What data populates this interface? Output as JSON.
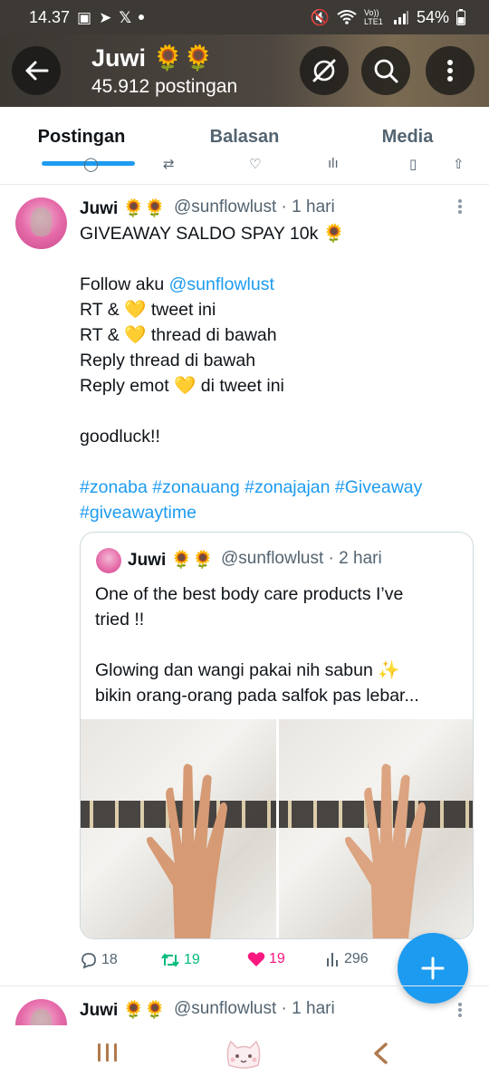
{
  "status_bar": {
    "time": "14.37",
    "battery": "54%",
    "net_label": "Vo)) LTE1"
  },
  "header": {
    "title": "Juwi 🌻🌻",
    "subtitle": "45.912 postingan"
  },
  "tabs": [
    {
      "label": "Postingan",
      "active": true
    },
    {
      "label": "Balasan",
      "active": false
    },
    {
      "label": "Media",
      "active": false
    }
  ],
  "tweet": {
    "name": "Juwi 🌻🌻",
    "handle": "@sunflowlust · 1 hari",
    "body": {
      "line1": "GIVEAWAY SALDO SPAY 10k 🌻",
      "follow_prefix": "Follow aku ",
      "follow_mention": "@sunflowlust",
      "line3": "RT & 💛 tweet ini",
      "line4": "RT & 💛 thread di bawah",
      "line5": "Reply thread di bawah",
      "line6": "Reply emot 💛 di tweet ini",
      "line7": "goodluck!!",
      "hashtags1": "#zonaba #zonauang #zonajajan #Giveaway",
      "hashtags2": "#giveawaytime"
    },
    "quote": {
      "name": "Juwi 🌻🌻",
      "handle": "@sunflowlust · 2 hari",
      "line1": "One of the best body care products I’ve",
      "line2": "tried !!",
      "line3": "Glowing dan wangi pakai nih sabun ✨",
      "line4": "bikin orang-orang pada salfok pas lebar..."
    },
    "actions": {
      "replies": "18",
      "retweets": "19",
      "likes": "19",
      "views": "296"
    }
  },
  "next_tweet": {
    "name": "Juwi 🌻🌻",
    "handle": "@sunflowlust · 1 hari"
  },
  "colors": {
    "accent": "#1d9bf0",
    "retweet": "#00ba7c",
    "like": "#f91880"
  }
}
